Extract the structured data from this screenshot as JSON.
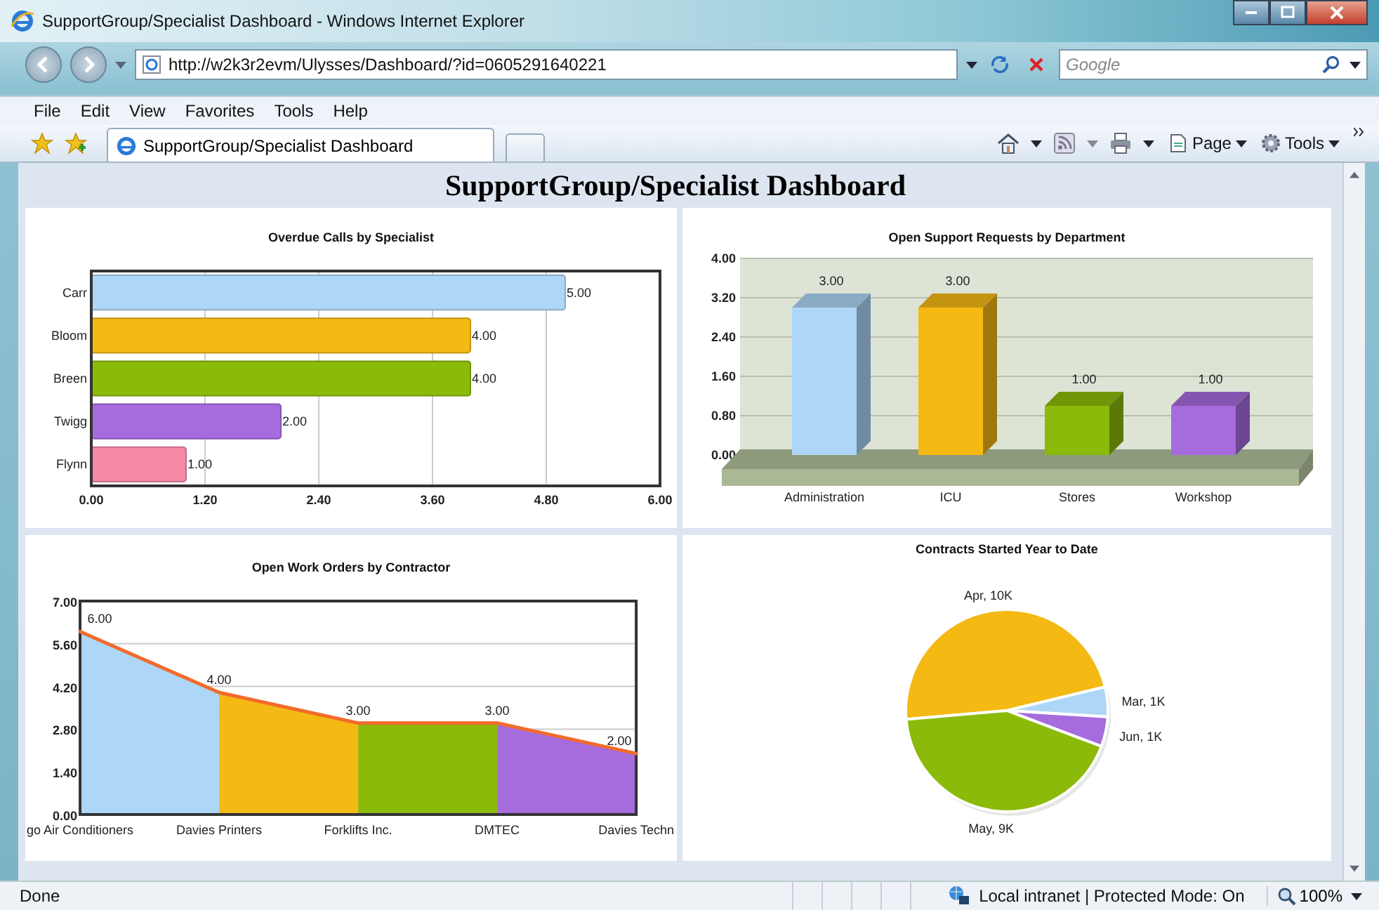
{
  "window": {
    "title": "SupportGroup/Specialist Dashboard - Windows Internet Explorer"
  },
  "address": {
    "url": "http://w2k3r2evm/Ulysses/Dashboard/?id=0605291640221"
  },
  "search": {
    "placeholder": "Google"
  },
  "menu": [
    "File",
    "Edit",
    "View",
    "Favorites",
    "Tools",
    "Help"
  ],
  "tab": {
    "label": "SupportGroup/Specialist Dashboard",
    "selected": true
  },
  "commands": [
    {
      "kind": "page",
      "label": "Page"
    },
    {
      "kind": "tools",
      "label": "Tools"
    }
  ],
  "page": {
    "heading": "SupportGroup/Specialist Dashboard",
    "charts": [
      {
        "chart_data": {
          "type": "bar",
          "orientation": "horizontal",
          "title": "Overdue Calls by Specialist",
          "categories": [
            "Carr",
            "Bloom",
            "Breen",
            "Twigg",
            "Flynn"
          ],
          "series": [
            {
              "values": [
                5,
                4,
                4,
                2,
                1
              ]
            }
          ],
          "grid": true,
          "colors": [
            "#aed6f6",
            "#f5b914",
            "#8cba0a",
            "#a66bdd",
            "#f48aa6"
          ],
          "value_labels": [
            "5.00",
            "4.00",
            "4.00",
            "2.00",
            "1.00"
          ],
          "xlim": [
            0,
            6
          ],
          "xticks": [
            {
              "value": 0,
              "label": "0.00"
            },
            {
              "value": 1.2,
              "label": "1.20"
            },
            {
              "value": 2.4,
              "label": "2.40"
            },
            {
              "value": 3.6,
              "label": "3.60"
            },
            {
              "value": 4.8,
              "label": "4.80"
            },
            {
              "value": 6,
              "label": "6.00"
            }
          ]
        }
      },
      {
        "chart_data": {
          "type": "bar",
          "orientation": "vertical",
          "title": "Open Support Requests by Department",
          "categories": [
            "Administration",
            "ICU",
            "Stores",
            "Workshop"
          ],
          "series": [
            {
              "values": [
                3,
                3,
                1,
                1
              ]
            }
          ],
          "grid": true,
          "colors": [
            "#aed6f6",
            "#f5b914",
            "#8cba0a",
            "#a66bdd"
          ],
          "value_labels": [
            "3.00",
            "3.00",
            "1.00",
            "1.00"
          ],
          "ylim": [
            0,
            4
          ],
          "yticks": [
            {
              "value": 0,
              "label": "0.00"
            },
            {
              "value": 0.8,
              "label": "0.80"
            },
            {
              "value": 1.6,
              "label": "1.60"
            },
            {
              "value": 2.4,
              "label": "2.40"
            },
            {
              "value": 3.2,
              "label": "3.20"
            },
            {
              "value": 4,
              "label": "4.00"
            }
          ]
        }
      },
      {
        "chart_data": {
          "type": "line",
          "title": "Open Work Orders by Contractor",
          "categories": [
            "go Air Conditioners",
            "Davies Printers",
            "Forklifts Inc.",
            "DMTEC",
            "Davies Techn"
          ],
          "series": [
            {
              "color": "#f26b2c",
              "values": [
                6,
                4,
                3,
                3,
                2
              ]
            }
          ],
          "grid": true,
          "colors": [
            "#aed6f6",
            "#f5b914",
            "#8cba0a",
            "#a66bdd"
          ],
          "value_labels": [
            "6.00",
            "4.00",
            "3.00",
            "3.00",
            "2.00"
          ],
          "ylim": [
            0,
            7
          ],
          "yticks": [
            {
              "value": 0,
              "label": "0.00"
            },
            {
              "value": 1.4,
              "label": "1.40"
            },
            {
              "value": 2.8,
              "label": "2.80"
            },
            {
              "value": 4.2,
              "label": "4.20"
            },
            {
              "value": 5.6,
              "label": "5.60"
            },
            {
              "value": 7,
              "label": "7.00"
            }
          ]
        }
      },
      {
        "chart_data": {
          "type": "pie",
          "title": "Contracts Started Year to Date",
          "categories": [
            "Apr, 10K",
            "Mar, 1K",
            "Jun, 1K",
            "May, 9K"
          ],
          "series": [
            {
              "values": [
                10000,
                1000,
                1000,
                9000
              ]
            }
          ],
          "colors": [
            "#f5b914",
            "#aed6f6",
            "#a66bdd",
            "#8cba0a"
          ]
        }
      }
    ]
  },
  "status_bar": {
    "text": "Done",
    "zone": "Local intranet | Protected Mode: On",
    "zoom": "100%"
  }
}
